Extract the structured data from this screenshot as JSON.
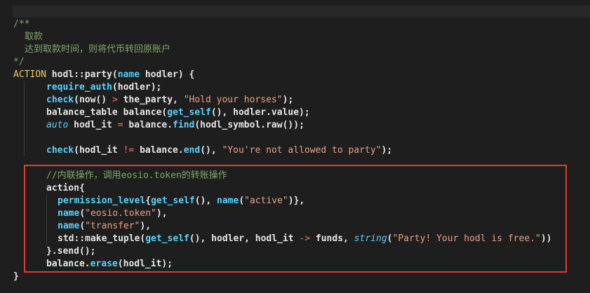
{
  "code": {
    "comment_open": "/**",
    "comment_line1": "取款",
    "comment_line2": "达到取款时间，则将代币转回原账户",
    "comment_close": "*/",
    "l_action": {
      "kw": "ACTION",
      "p1": " hodl::party(",
      "type": "name",
      "p2": " hodler) {"
    },
    "l_require": {
      "fn": "require_auth",
      "rest": "(hodler);"
    },
    "l_check1": {
      "fn": "check",
      "p1": "(now() ",
      "op": ">",
      "p2": " the_party, ",
      "str": "\"Hold your horses\"",
      "p3": ");"
    },
    "l_balance": {
      "p1": "balance_table balance(",
      "fn": "get_self",
      "p2": "(), hodler.value);"
    },
    "l_auto": {
      "type": "auto",
      "p1": " hodl_it ",
      "op": "=",
      "p2": " balance.",
      "fn": "find",
      "p3": "(hodl_symbol.raw());"
    },
    "l_check2": {
      "fn": "check",
      "p1": "(hodl_it ",
      "op": "!=",
      "p2": " balance.",
      "fn2": "end",
      "p3": "(), ",
      "str": "\"You're not allowed to party\"",
      "p4": ");"
    },
    "l_comment2": "//内联操作，调用eosio.token的转账操作",
    "l_action2": "action{",
    "l_perm": {
      "fn": "permission_level",
      "p1": "{",
      "fn2": "get_self",
      "p2": "(), ",
      "fn3": "name",
      "p3": "(",
      "str": "\"active\"",
      "p4": ")},"
    },
    "l_name1": {
      "fn": "name",
      "p1": "(",
      "str": "\"eosio.token\"",
      "p2": "),"
    },
    "l_name2": {
      "fn": "name",
      "p1": "(",
      "str": "\"transfer\"",
      "p2": "),"
    },
    "l_tuple": {
      "p1": "std::make_tuple(",
      "fn": "get_self",
      "p2": "(), hodler, hodl_it ",
      "op": "->",
      "p3": " funds, ",
      "type": "string",
      "p4": "(",
      "str": "\"Party! Your hodl is free.\"",
      "p5": "))"
    },
    "l_send": "}.send();",
    "l_erase": {
      "p1": "balance.",
      "fn": "erase",
      "p2": "(hodl_it);"
    },
    "l_close": "}"
  },
  "colors": {
    "background": "#1e1e1e",
    "comment": "#7fa86a",
    "keyword": "#4ec9ff",
    "string": "#e8a183",
    "operator": "#ff6f61",
    "highlight_border": "#e53935"
  }
}
